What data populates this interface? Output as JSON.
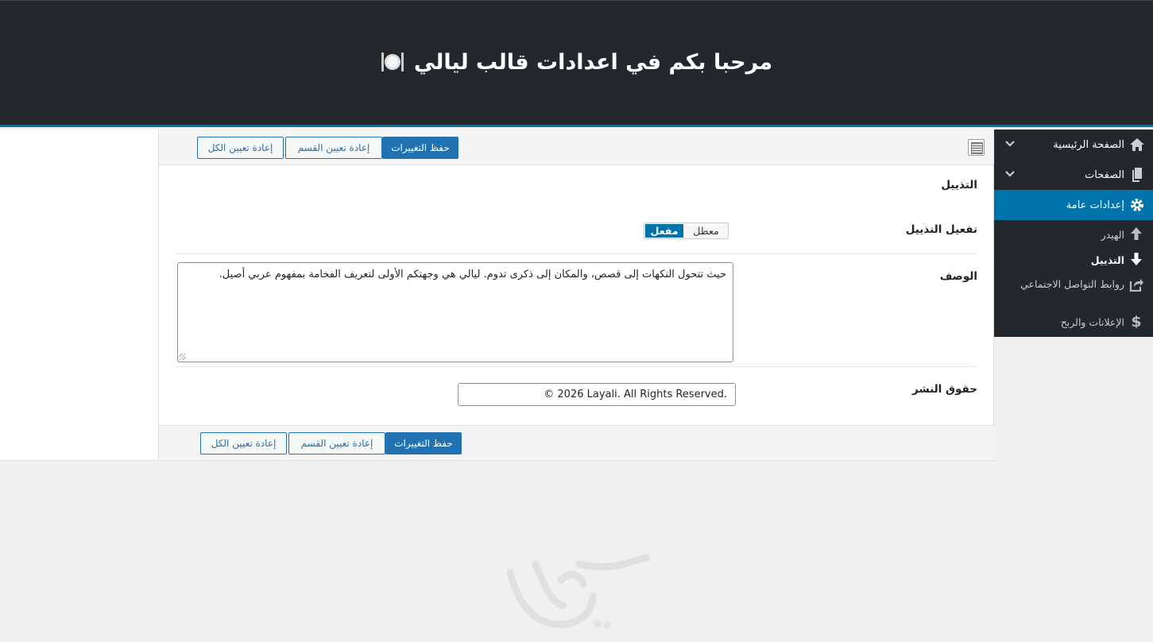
{
  "header": {
    "title": "مرحبا بكم في اعدادات قالب ليالي",
    "plate_icon": "plate-cutlery-icon"
  },
  "sidebar": {
    "items": [
      {
        "label": "الصفحة الرئيسية",
        "icon": "home-icon",
        "has_chevron": true
      },
      {
        "label": "الصفحات",
        "icon": "pages-icon",
        "has_chevron": true
      },
      {
        "label": "إعدادات عامة",
        "icon": "gear-icon",
        "active": true
      }
    ],
    "subitems": [
      {
        "label": "الهيدر",
        "icon": "arrow-up-icon"
      },
      {
        "label": "التذييل",
        "icon": "arrow-down-icon",
        "current": true
      },
      {
        "label": "روابط التواصل الاجتماعي",
        "icon": "share-icon"
      },
      {
        "label": "الإعلانات والربح",
        "icon": "dollar-icon"
      }
    ]
  },
  "toolbar": {
    "save_label": "حفظ التغييرات",
    "reset_section_label": "إعادة تعيين القسم",
    "reset_all_label": "إعادة تعيين الكل"
  },
  "section": {
    "title": "التذييل",
    "fields": {
      "enable_label": "تفعيل التذييل",
      "enable_on": "مفعل",
      "enable_off": "معطل",
      "enable_value": "on",
      "description_label": "الوصف",
      "description_value": "حيث تتحول النكهات إلى قصص، والمكان إلى ذكرى تدوم. ليالي هي وجهتكم الأولى لتعريف الفخامة بمفهوم عربي أصيل.",
      "copyright_label": "حقوق النشر",
      "copyright_value": "© 2026 Layali. All Rights Reserved."
    }
  },
  "colors": {
    "header_bg": "#23282d",
    "accent": "#0073aa",
    "button_primary": "#2271b1"
  }
}
